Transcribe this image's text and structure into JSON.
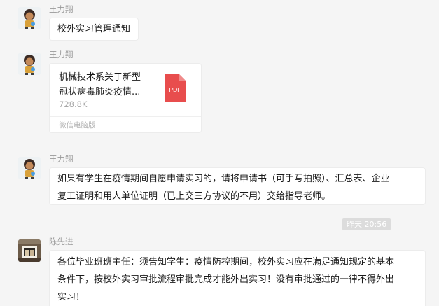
{
  "messages": [
    {
      "sender": "王力翔",
      "text": "校外实习管理通知"
    },
    {
      "sender": "王力翔",
      "file": {
        "name_line1": "机械技术系关于新型",
        "name_line2": "冠状病毒肺炎疫情...",
        "size": "728.8K",
        "source": "微信电脑版",
        "type_label": "PDF",
        "icon": "pdf-file-icon"
      }
    },
    {
      "sender": "王力翔",
      "lines": [
        "如果有学生在疫情期间自愿申请实习的，请将申请书（可手写拍照）、汇总表、企业",
        "复工证明和用人单位证明（已上交三方协议的不用）交给指导老师。"
      ]
    },
    {
      "sender": "陈先进",
      "lines": [
        "各位毕业班班主任：须告知学生：疫情防控期间，校外实习应在满足通知规定的基本",
        "条件下，按校外实习审批流程审批完成才能外出实习！没有审批通过的一律不得外出",
        "实习！"
      ]
    }
  ],
  "timestamp": "昨天 20:56",
  "colors": {
    "background": "#f5f5f5",
    "bubble": "#ffffff",
    "pdf_red": "#e84d4d",
    "timestamp_bg": "#dcdcdc"
  }
}
